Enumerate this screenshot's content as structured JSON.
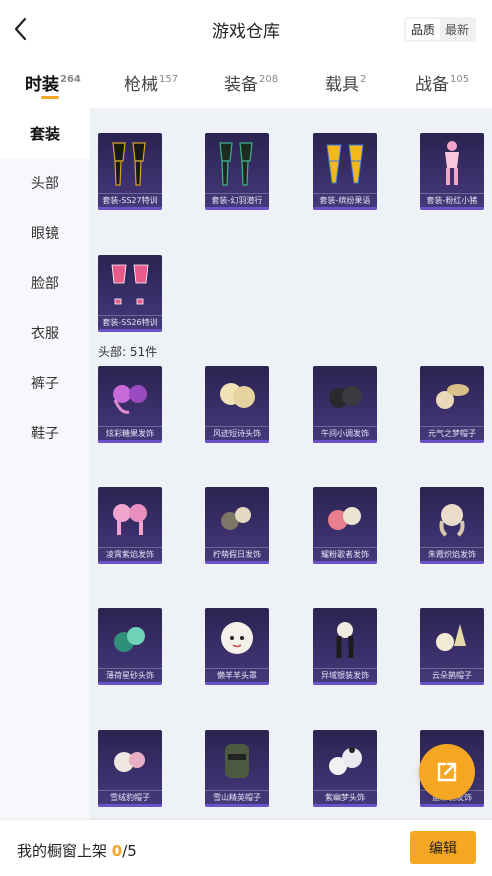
{
  "header": {
    "title": "游戏仓库",
    "sort_options": [
      "品质",
      "最新"
    ]
  },
  "tabs": [
    {
      "label": "时装",
      "count": "264"
    },
    {
      "label": "枪械",
      "count": "157"
    },
    {
      "label": "装备",
      "count": "208"
    },
    {
      "label": "载具",
      "count": "2"
    },
    {
      "label": "战备",
      "count": "105"
    }
  ],
  "sidebar": {
    "items": [
      "套装",
      "头部",
      "眼镜",
      "脸部",
      "衣服",
      "裤子",
      "鞋子"
    ]
  },
  "sections": [
    {
      "label": "",
      "items": [
        "套装-SS27特训",
        "套装-幻羽潜行",
        "套装-缤纷果语",
        "套装-粉红小猪",
        "套装-SS26特训"
      ]
    },
    {
      "label": "头部: 51件",
      "items": [
        "炫彩糖果发饰",
        "风迹短诗头饰",
        "午间小调发饰",
        "元气之梦帽子",
        "凌霄紫焰发饰",
        "柠萌假日发饰",
        "耀粉歌者发饰",
        "朱霞炽焰发饰",
        "薄荷星砂头饰",
        "懒羊羊头罩",
        "异域银装发饰",
        "云朵鹊帽子",
        "雪绒豹帽子",
        "雪山精英帽子",
        "紫幽梦头饰",
        "蓝彩羽发饰"
      ]
    }
  ],
  "footer": {
    "label": "我的橱窗上架",
    "shown": "0",
    "total": "/5",
    "edit_label": "编辑"
  },
  "colors": {
    "accent": "#f5a623",
    "card_bg": "#2b2350",
    "card_bar": "#6c52c8"
  }
}
